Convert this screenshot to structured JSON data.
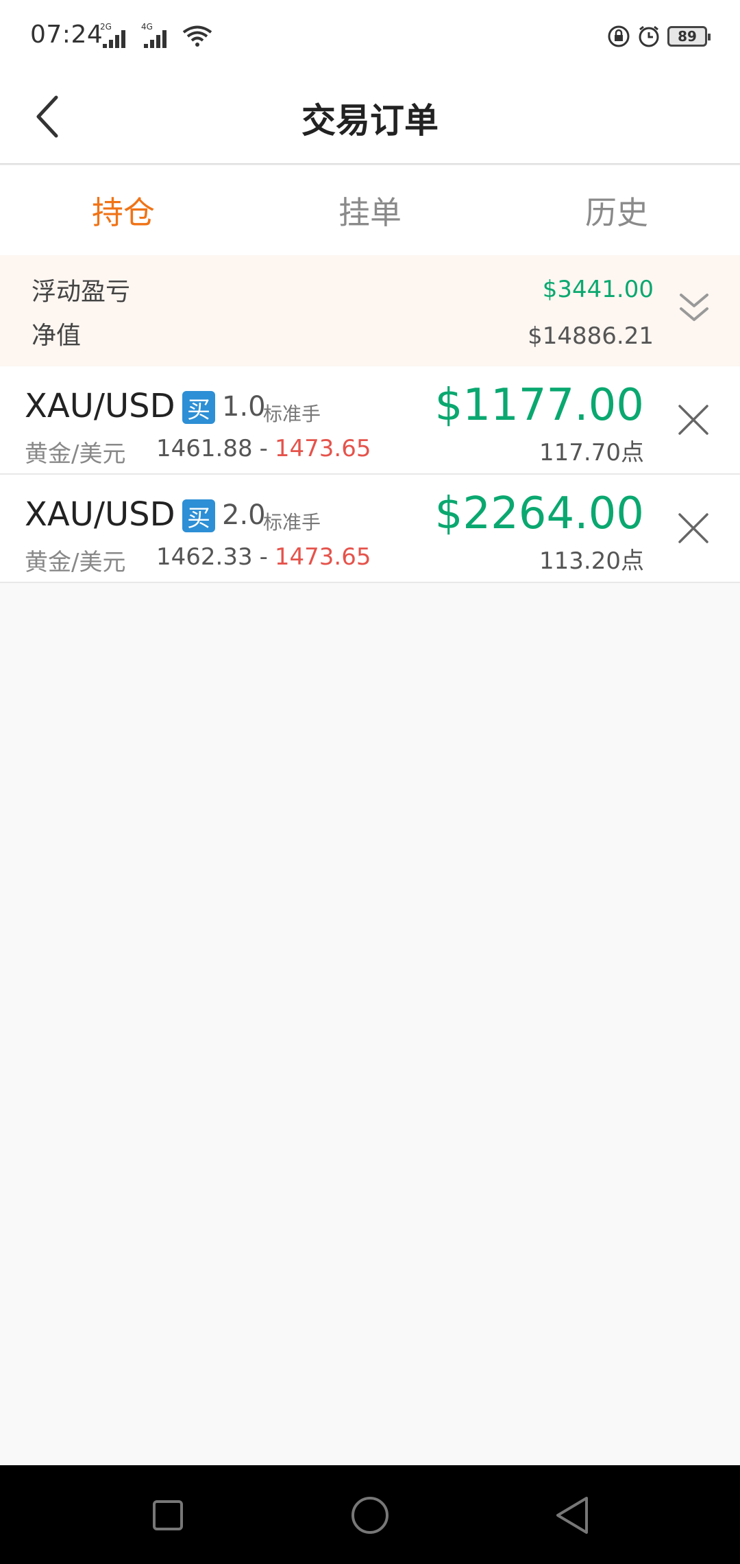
{
  "status_bar": {
    "time": "07:24",
    "signal_1_label": "2G",
    "signal_2_label": "4G",
    "battery": "89",
    "icons": [
      "signal-icon",
      "signal-icon",
      "wifi-icon",
      "lock-rotation-icon",
      "alarm-icon",
      "battery-icon"
    ]
  },
  "header": {
    "title": "交易订单",
    "back_icon": "chevron-left-icon"
  },
  "tabs": [
    {
      "label": "持仓",
      "active": true
    },
    {
      "label": "挂单",
      "active": false
    },
    {
      "label": "历史",
      "active": false
    }
  ],
  "summary": {
    "floating_pl_label": "浮动盈亏",
    "floating_pl_value": "$3441.00",
    "equity_label": "净值",
    "equity_value": "$14886.21",
    "expand_icon": "double-chevron-down-icon"
  },
  "positions": [
    {
      "symbol": "XAU/USD",
      "side": "买",
      "lots": "1.0",
      "unit": "标准手",
      "name": "黄金/美元",
      "open_price": "1461.88",
      "separator": "-",
      "current_price": "1473.65",
      "profit": "$1177.00",
      "points": "117.70点"
    },
    {
      "symbol": "XAU/USD",
      "side": "买",
      "lots": "2.0",
      "unit": "标准手",
      "name": "黄金/美元",
      "open_price": "1462.33",
      "separator": "-",
      "current_price": "1473.65",
      "profit": "$2264.00",
      "points": "113.20点"
    }
  ],
  "colors": {
    "accent": "#f07316",
    "profit_green": "#0aa870",
    "price_red": "#e5534b",
    "buy_blue": "#2d8fd5",
    "summary_bg": "#fdf6f1"
  },
  "nav_bar": {
    "icons": [
      "square-recents-icon",
      "circle-home-icon",
      "triangle-back-icon"
    ]
  }
}
